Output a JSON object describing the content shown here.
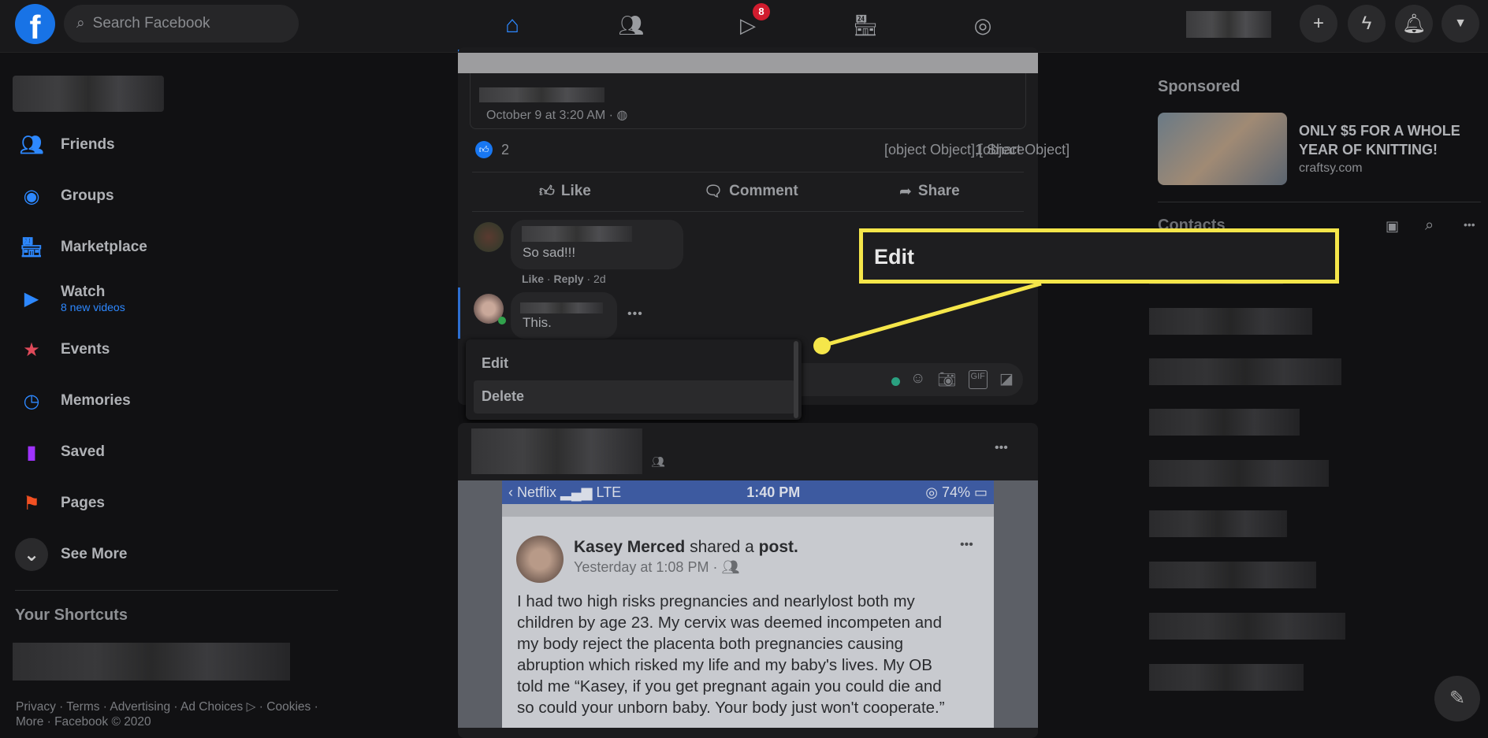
{
  "topbar": {
    "search_placeholder": "Search Facebook",
    "watch_badge": "8",
    "nav": [
      "home-icon",
      "friends-icon",
      "watch-icon",
      "marketplace-icon",
      "groups-icon"
    ]
  },
  "sidebar": {
    "items": [
      {
        "label": "Friends",
        "icon": "friends-icon",
        "color": "#2d88ff"
      },
      {
        "label": "Groups",
        "icon": "groups-icon",
        "color": "#2d88ff"
      },
      {
        "label": "Marketplace",
        "icon": "marketplace-icon",
        "color": "#2d88ff"
      },
      {
        "label": "Watch",
        "sub": "8 new videos",
        "icon": "watch-icon",
        "color": "#2d88ff"
      },
      {
        "label": "Events",
        "icon": "events-icon",
        "color": "#e04a5a"
      },
      {
        "label": "Memories",
        "icon": "memories-icon",
        "color": "#2d88ff"
      },
      {
        "label": "Saved",
        "icon": "saved-icon",
        "color": "#a033ff"
      },
      {
        "label": "Pages",
        "icon": "pages-icon",
        "color": "#f25022"
      },
      {
        "label": "See More",
        "icon": "chevron-down-icon",
        "color": "#3a3b3c"
      }
    ],
    "shortcuts_title": "Your Shortcuts",
    "footer_line1": "Privacy · Terms · Advertising · Ad Choices ▷ · Cookies ·",
    "footer_line2": "More · Facebook © 2020"
  },
  "post1": {
    "date": "October 9 at 3:20 AM ·",
    "likes": "2",
    "comments": [
      {
        "text": "So sad!!!",
        "meta_like": "Like",
        "meta_reply": "Reply",
        "meta_time": "2d"
      },
      {
        "text": "This."
      }
    ],
    "shares": "1 Share",
    "actions": {
      "like": "Like",
      "comment": "Comment",
      "share": "Share"
    },
    "menu": {
      "edit": "Edit",
      "delete": "Delete"
    }
  },
  "callout": {
    "label": "Edit",
    "color": "#f5e64a"
  },
  "post2": {
    "status": {
      "back": "Netflix",
      "network": "LTE",
      "time": "1:40 PM",
      "battery": "74%"
    },
    "author": "Kasey Merced",
    "shared": "shared a",
    "post_word": "post.",
    "time": "Yesterday at 1:08 PM ·",
    "lines": [
      "I had two high risks pregnancies and nearlylost both my",
      "children by age 23. My cervix was deemed incompeten and",
      "my body reject the placenta both pregnancies causing",
      "abruption which risked my life and my baby's lives. My OB",
      "told me “Kasey, if you get pregnant again you could die and",
      "so could your unborn baby. Your body just won't cooperate.”"
    ]
  },
  "right": {
    "sponsored": "Sponsored",
    "ad_title": "ONLY $5 FOR A WHOLE YEAR OF KNITTING!",
    "ad_domain": "craftsy.com",
    "contacts": "Contacts"
  }
}
